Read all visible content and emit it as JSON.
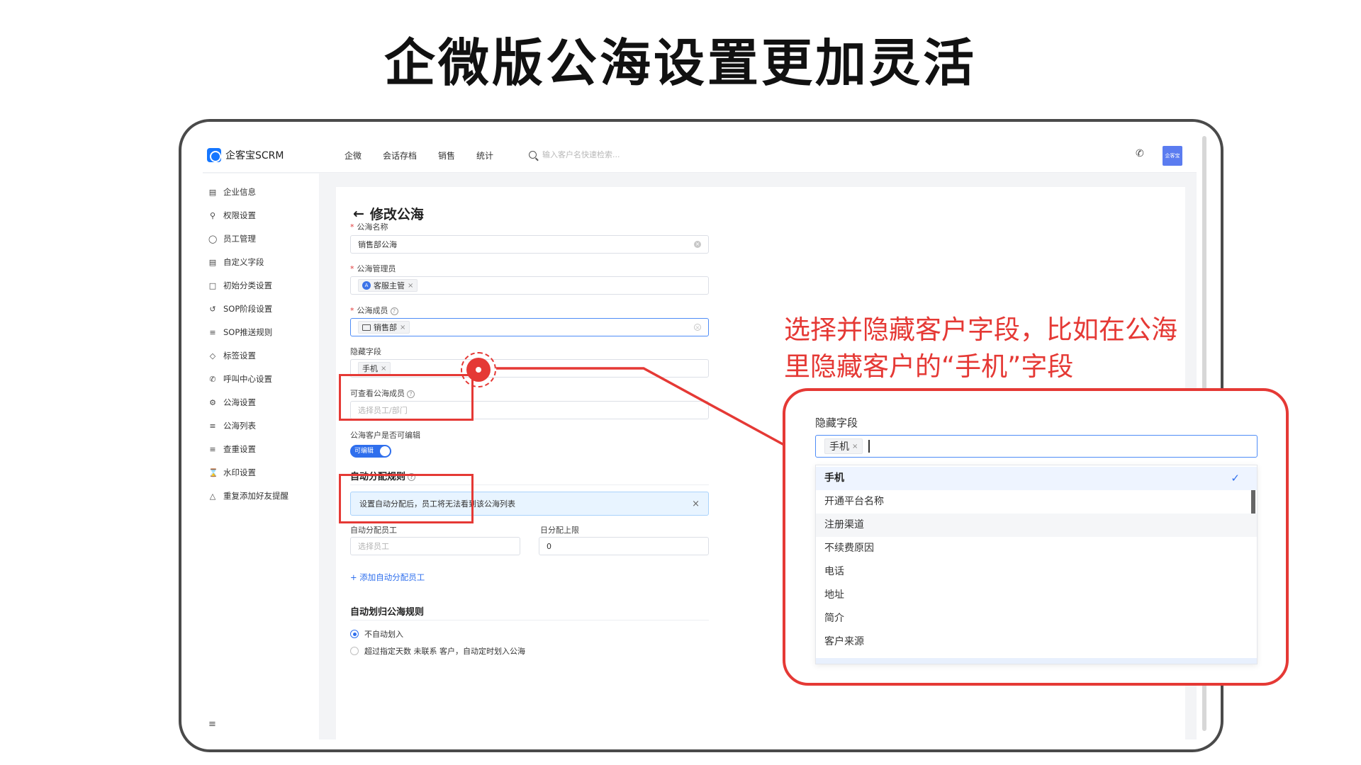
{
  "headline": "企微版公海设置更加灵活",
  "app": {
    "brand": "企客宝SCRM",
    "nav": [
      "企微",
      "会话存档",
      "销售",
      "统计"
    ],
    "search_placeholder": "输入客户名快速检索...",
    "avatar_text": "企客宝"
  },
  "sidebar": {
    "items": [
      {
        "label": "企业信息",
        "icon": "id-card-icon"
      },
      {
        "label": "权限设置",
        "icon": "key-icon"
      },
      {
        "label": "员工管理",
        "icon": "user-icon"
      },
      {
        "label": "自定义字段",
        "icon": "form-icon"
      },
      {
        "label": "初始分类设置",
        "icon": "box-icon"
      },
      {
        "label": "SOP阶段设置",
        "icon": "flow-icon"
      },
      {
        "label": "SOP推送规则",
        "icon": "list-icon"
      },
      {
        "label": "标签设置",
        "icon": "tag-icon"
      },
      {
        "label": "呼叫中心设置",
        "icon": "phone-icon"
      },
      {
        "label": "公海设置",
        "icon": "gear-icon"
      },
      {
        "label": "公海列表",
        "icon": "menu-icon"
      },
      {
        "label": "查重设置",
        "icon": "list-icon"
      },
      {
        "label": "水印设置",
        "icon": "hourglass-icon"
      },
      {
        "label": "重复添加好友提醒",
        "icon": "bell-icon"
      }
    ]
  },
  "form": {
    "title": "修改公海",
    "name_label": "公海名称",
    "name_value": "销售部公海",
    "admin_label": "公海管理员",
    "admin_tag": "客服主管",
    "admin_avatar": "A",
    "member_label": "公海成员",
    "member_tag": "销售部",
    "hidden_label": "隐藏字段",
    "hidden_tag": "手机",
    "viewer_label": "可查看公海成员",
    "viewer_placeholder": "选择员工/部门",
    "editable_label": "公海客户是否可编辑",
    "editable_toggle": "可编辑",
    "auto_assign_title": "自动分配规则",
    "auto_assign_notice": "设置自动分配后，员工将无法看到该公海列表",
    "auto_staff_label": "自动分配员工",
    "auto_staff_placeholder": "选择员工",
    "daily_limit_label": "日分配上限",
    "daily_limit_value": "0",
    "add_staff_link": "添加自动分配员工",
    "auto_return_title": "自动划归公海规则",
    "radio_1": "不自动划入",
    "radio_2": "超过指定天数 未联系 客户，自动定时划入公海"
  },
  "annotation": {
    "line1": "选择并隐藏客户字段，比如在公海",
    "line2": "里隐藏客户的“手机”字段"
  },
  "zoom": {
    "label": "隐藏字段",
    "tag": "手机",
    "options": [
      "手机",
      "开通平台名称",
      "注册渠道",
      "不续费原因",
      "电话",
      "地址",
      "简介",
      "客户来源"
    ],
    "selected": "手机",
    "check_icon": "check-icon"
  },
  "colors": {
    "accent": "#2f6fed",
    "highlight": "#e53935"
  }
}
